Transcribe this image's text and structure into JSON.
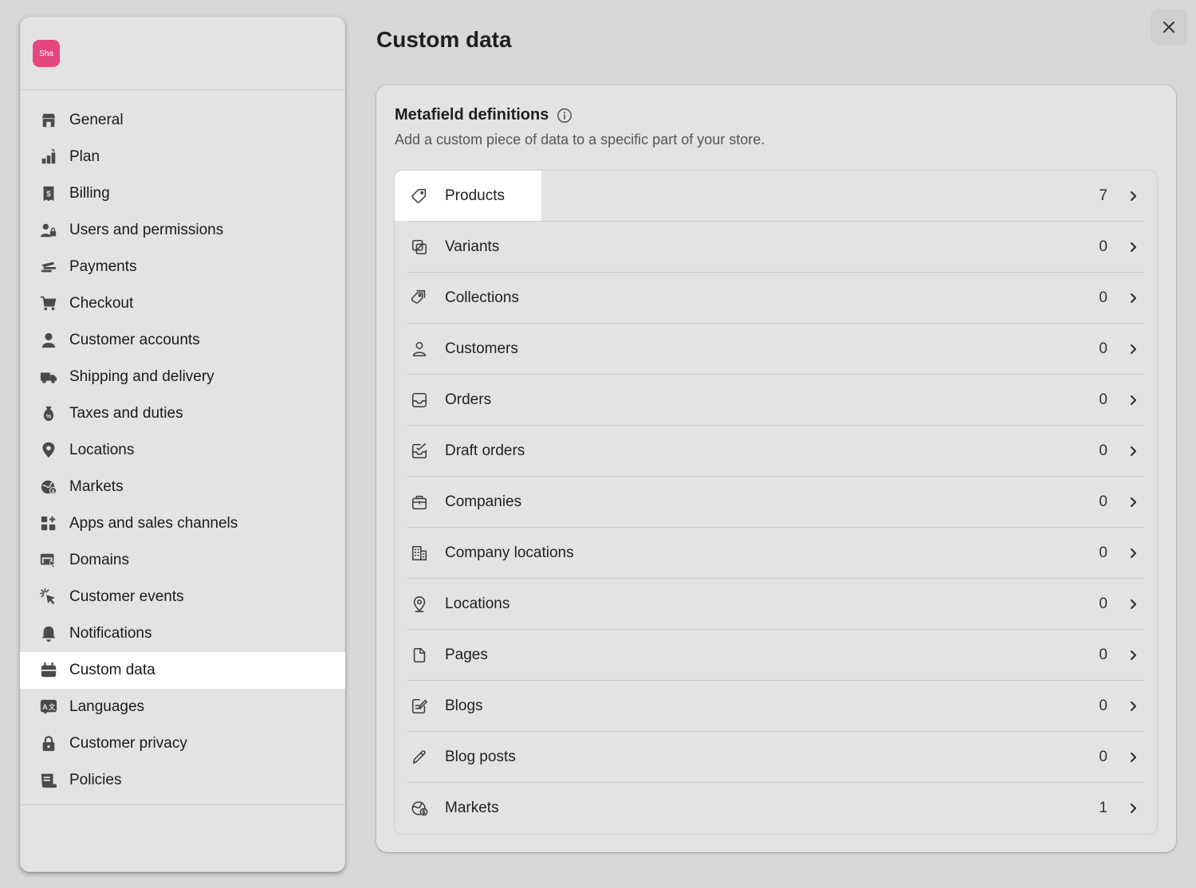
{
  "store": {
    "avatar_text": "Sha",
    "avatar_color": "#e5467d"
  },
  "sidebar": {
    "items": [
      {
        "label": "General",
        "icon": "store-icon"
      },
      {
        "label": "Plan",
        "icon": "plan-icon"
      },
      {
        "label": "Billing",
        "icon": "billing-icon"
      },
      {
        "label": "Users and permissions",
        "icon": "users-icon"
      },
      {
        "label": "Payments",
        "icon": "payments-icon"
      },
      {
        "label": "Checkout",
        "icon": "cart-icon"
      },
      {
        "label": "Customer accounts",
        "icon": "person-icon"
      },
      {
        "label": "Shipping and delivery",
        "icon": "truck-icon"
      },
      {
        "label": "Taxes and duties",
        "icon": "tax-icon"
      },
      {
        "label": "Locations",
        "icon": "location-pin-icon"
      },
      {
        "label": "Markets",
        "icon": "globe-icon"
      },
      {
        "label": "Apps and sales channels",
        "icon": "apps-icon"
      },
      {
        "label": "Domains",
        "icon": "domains-icon"
      },
      {
        "label": "Customer events",
        "icon": "cursor-click-icon"
      },
      {
        "label": "Notifications",
        "icon": "bell-icon"
      },
      {
        "label": "Custom data",
        "icon": "custom-data-icon",
        "active": true
      },
      {
        "label": "Languages",
        "icon": "languages-icon"
      },
      {
        "label": "Customer privacy",
        "icon": "lock-icon"
      },
      {
        "label": "Policies",
        "icon": "policies-icon"
      }
    ]
  },
  "main": {
    "title": "Custom data",
    "close_icon": "close-icon"
  },
  "metafields": {
    "title": "Metafield definitions",
    "subtitle": "Add a custom piece of data to a specific part of your store.",
    "rows": [
      {
        "label": "Products",
        "count": "7",
        "icon": "tag-icon",
        "highlighted": true
      },
      {
        "label": "Variants",
        "count": "0",
        "icon": "variants-icon"
      },
      {
        "label": "Collections",
        "count": "0",
        "icon": "collections-icon"
      },
      {
        "label": "Customers",
        "count": "0",
        "icon": "person-outline-icon"
      },
      {
        "label": "Orders",
        "count": "0",
        "icon": "inbox-icon"
      },
      {
        "label": "Draft orders",
        "count": "0",
        "icon": "draft-order-icon"
      },
      {
        "label": "Companies",
        "count": "0",
        "icon": "briefcase-icon"
      },
      {
        "label": "Company locations",
        "count": "0",
        "icon": "building-icon"
      },
      {
        "label": "Locations",
        "count": "0",
        "icon": "location-outline-icon"
      },
      {
        "label": "Pages",
        "count": "0",
        "icon": "page-icon"
      },
      {
        "label": "Blogs",
        "count": "0",
        "icon": "blog-icon"
      },
      {
        "label": "Blog posts",
        "count": "0",
        "icon": "pencil-icon"
      },
      {
        "label": "Markets",
        "count": "1",
        "icon": "globe-outline-icon"
      }
    ]
  }
}
